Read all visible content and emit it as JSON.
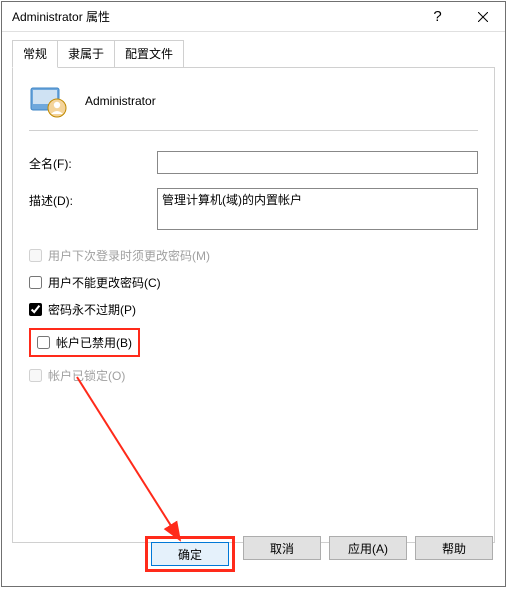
{
  "titlebar": {
    "text": "Administrator 属性"
  },
  "tabs": [
    "常规",
    "隶属于",
    "配置文件"
  ],
  "identity": {
    "username": "Administrator"
  },
  "fields": {
    "fullname_label": "全名(F):",
    "fullname_value": "",
    "description_label": "描述(D):",
    "description_value": "管理计算机(域)的内置帐户"
  },
  "checkboxes": {
    "must_change": {
      "label": "用户下次登录时须更改密码(M)",
      "checked": false,
      "disabled": true
    },
    "cannot_change": {
      "label": "用户不能更改密码(C)",
      "checked": false,
      "disabled": false
    },
    "never_expires": {
      "label": "密码永不过期(P)",
      "checked": true,
      "disabled": false
    },
    "disabled_acct": {
      "label": "帐户已禁用(B)",
      "checked": false,
      "disabled": false
    },
    "locked": {
      "label": "帐户已锁定(O)",
      "checked": false,
      "disabled": true
    }
  },
  "buttons": {
    "ok": "确定",
    "cancel": "取消",
    "apply": "应用(A)",
    "help": "帮助"
  },
  "annotations": {
    "highlight_color": "#ff2a1a"
  }
}
